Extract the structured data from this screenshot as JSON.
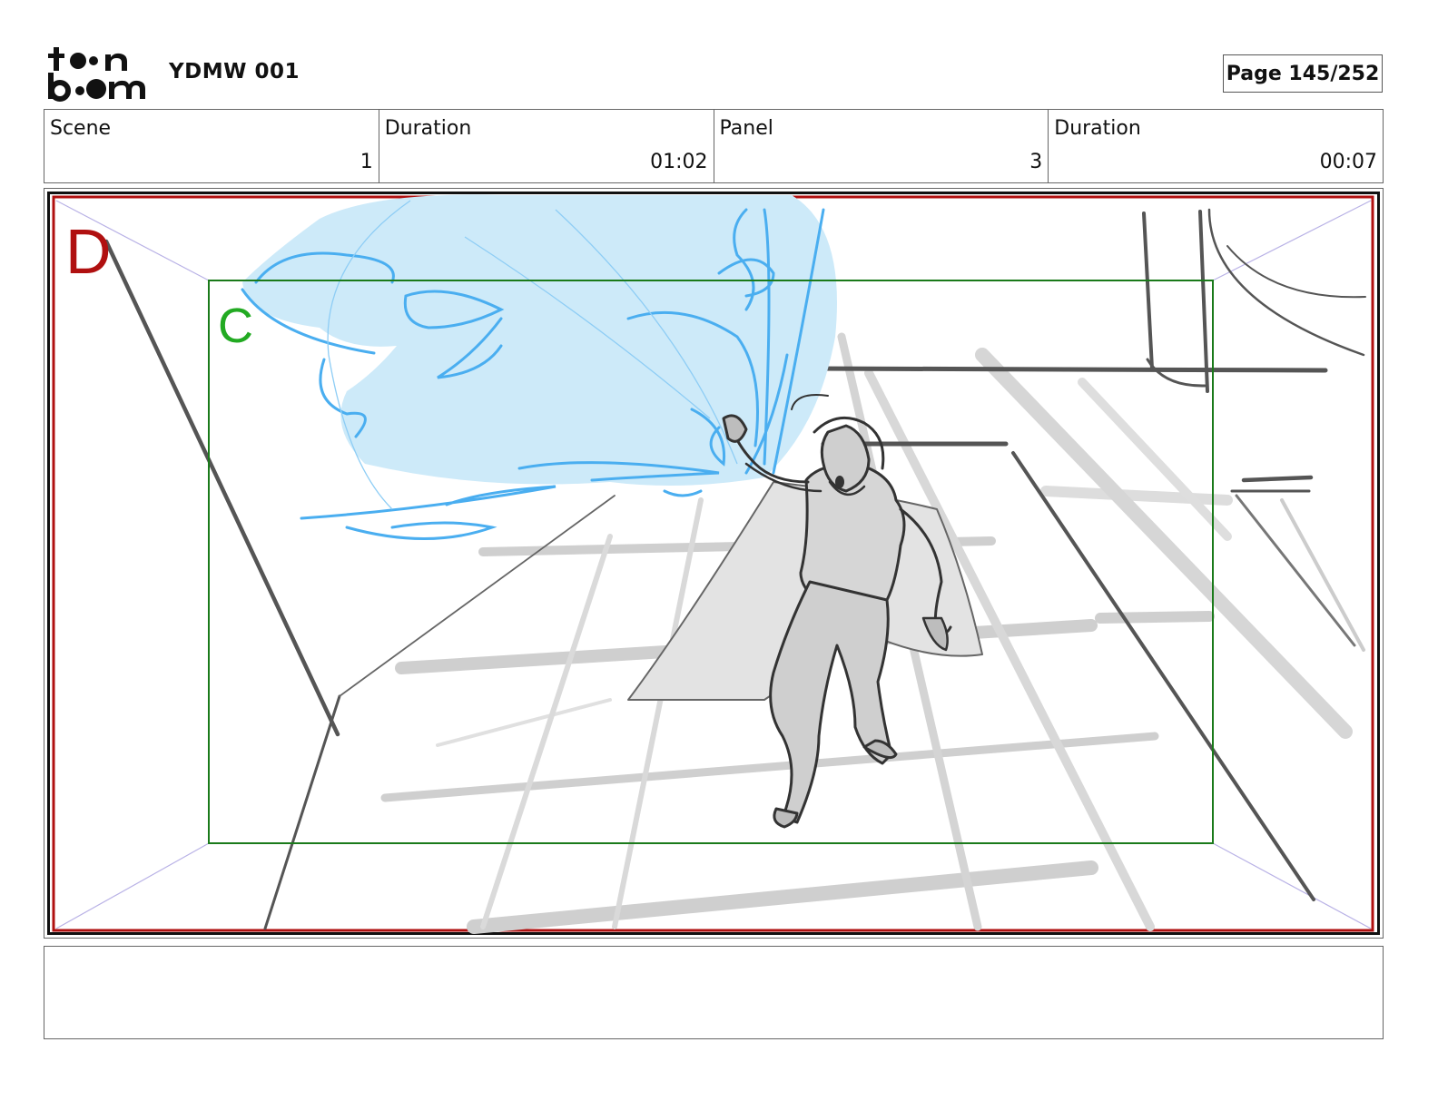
{
  "header": {
    "logo_text": "toon boom",
    "project_title": "YDMW 001",
    "page_label": "Page 145/252"
  },
  "info": {
    "scene_label": "Scene",
    "scene_value": "1",
    "scene_duration_label": "Duration",
    "scene_duration_value": "01:02",
    "panel_label": "Panel",
    "panel_value": "3",
    "panel_duration_label": "Duration",
    "panel_duration_value": "00:07"
  },
  "panel": {
    "outer_frame_letter": "D",
    "inner_frame_letter": "C",
    "outer_frame_color": "#b01010",
    "inner_frame_color": "#1a7a1a",
    "energy_color": "#4aaef0",
    "energy_fill_color": "#cdeaf9",
    "sketch_color": "#333333"
  },
  "notes": {
    "text": ""
  }
}
